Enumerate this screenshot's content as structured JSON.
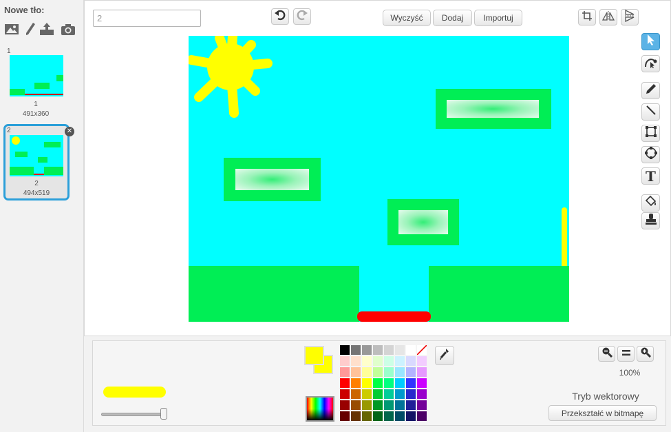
{
  "sidebar": {
    "new_background_label": "Nowe tło:",
    "tools": [
      {
        "icon": "image-icon"
      },
      {
        "icon": "paintbrush-icon"
      },
      {
        "icon": "upload-icon"
      },
      {
        "icon": "camera-icon"
      }
    ],
    "backgrounds": [
      {
        "number": "1",
        "name": "1",
        "size": "491x360",
        "selected": false
      },
      {
        "number": "2",
        "name": "2",
        "size": "494x519",
        "selected": true
      }
    ]
  },
  "editor": {
    "name_value": "2",
    "name_placeholder": "",
    "undo_icon": "undo-icon",
    "redo_icon": "redo-icon",
    "buttons": {
      "clear": "Wyczyść",
      "add": "Dodaj",
      "import": "Importuj"
    },
    "top_right_icons": [
      "crop-icon",
      "flip-horizontal-icon",
      "flip-vertical-icon"
    ],
    "tools": [
      {
        "icon": "select-arrow-icon",
        "active": true
      },
      {
        "icon": "reshape-icon",
        "active": false
      },
      {
        "icon": "pencil-icon",
        "active": false
      },
      {
        "icon": "line-icon",
        "active": false
      },
      {
        "icon": "rectangle-icon",
        "active": false
      },
      {
        "icon": "ellipse-icon",
        "active": false
      },
      {
        "icon": "text-icon",
        "active": false,
        "glyph": "T"
      },
      {
        "icon": "fill-bucket-icon",
        "active": false
      },
      {
        "icon": "stamp-icon",
        "active": false
      }
    ]
  },
  "options": {
    "primary_color": "#ffff00",
    "secondary_color": "#ffff00",
    "zoom": "100%",
    "mode_label": "Tryb wektorowy",
    "convert_button": "Przekształć w bitmapę",
    "zoom_out_icon": "zoom-out-icon",
    "zoom_reset_icon": "zoom-reset-icon",
    "zoom_in_icon": "zoom-in-icon",
    "eyedropper_icon": "eyedropper-icon",
    "palette": [
      [
        "#000000",
        "#757575",
        "#999999",
        "#bdbdbd",
        "#d4d4d4",
        "#e6e6e6",
        "#ffffff",
        "transparent"
      ],
      [
        "#ffcccc",
        "#ffe0cc",
        "#ffffcc",
        "#e0ffcc",
        "#ccffe6",
        "#ccf2ff",
        "#d9d9ff",
        "#f2ccff"
      ],
      [
        "#ff9999",
        "#ffc299",
        "#ffff99",
        "#c2ff99",
        "#99ffcc",
        "#99e6ff",
        "#b3b3ff",
        "#e699ff"
      ],
      [
        "#ff0000",
        "#ff8000",
        "#ffff00",
        "#00ff44",
        "#00ff80",
        "#00ccff",
        "#3333ff",
        "#cc00ff"
      ],
      [
        "#cc0000",
        "#cc6600",
        "#cccc00",
        "#00cc33",
        "#00cc99",
        "#0099cc",
        "#2929cc",
        "#9900cc"
      ],
      [
        "#990000",
        "#994c00",
        "#999900",
        "#009926",
        "#009973",
        "#007399",
        "#1f1f99",
        "#730099"
      ],
      [
        "#660000",
        "#663300",
        "#666600",
        "#00661a",
        "#00664c",
        "#004c66",
        "#141466",
        "#4c0066"
      ]
    ]
  },
  "colors": {
    "sky": "#00ffff",
    "ground": "#00ee55",
    "sun": "#ffff00",
    "lava": "#ff0000",
    "selection_blue": "#2b9fd9"
  }
}
